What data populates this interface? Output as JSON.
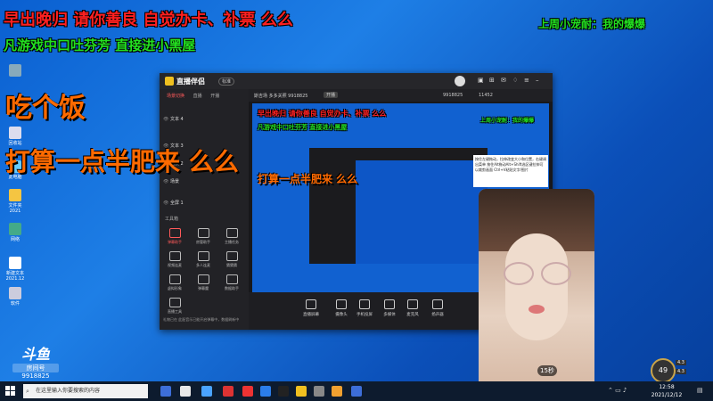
{
  "overlay": {
    "line1": "早出晚归 请你善良  自觉办卡、补票 么么",
    "line2": "凡游戏中口吐芬芳 直接进小黑屋",
    "top_right": "上周小宠耐：我的爆爆",
    "eat": "吃个饭",
    "plan": "打算一点半肥来 么么"
  },
  "desktop_icons": [
    {
      "label": ""
    },
    {
      "label": "回收站"
    },
    {
      "label": "此电脑"
    },
    {
      "label": "文件夹 2021"
    },
    {
      "label": "网络"
    },
    {
      "label": "新建文本 2021.12"
    },
    {
      "label": "软件"
    }
  ],
  "app": {
    "logo": "直播伴侣",
    "logo_tag": "标准",
    "tabs": [
      "场景切换",
      "直播",
      "开播"
    ],
    "scenes": [
      "文本 4",
      "文本 3",
      "场景 2",
      "场景",
      "全屏 1"
    ],
    "tools_title": "工具箱",
    "tools": [
      "弹幕助手",
      "房管助手",
      "主播任务",
      "视频连麦",
      "多人连麦",
      "猜猜猜",
      "虚拟形象",
      "弹幕魔",
      "数据助手",
      "直播工具"
    ],
    "status": "礼物已在   此配音乐已能开启弹幕中，数据刷新中",
    "room": "斯吉场   多多关照 9918825",
    "infobar_tag": "开播",
    "room_id": "9918825",
    "viewers": "11452",
    "buttons": [
      "直播屏幕",
      "摄像头",
      "手机投屏",
      "多媒体",
      "麦克风",
      "扬声器"
    ],
    "tooltip": "按住左键拖动，拉伸改变大小和位置，右键调出菜单 按住Alt拖动Alt+Shift选区键拉伸可以裁剪画面 Ctrl+V粘贴文字/图片"
  },
  "preview": {
    "line1": "早出晚归 请你善良  自觉办卡、补票 么么",
    "line2": "凡游戏中口吐芬芳 直接进小黑屋",
    "top_right": "上周小宠耐：我的爆爆",
    "plan": "打算一点半肥来 么么"
  },
  "camera": {
    "duration": "15秒"
  },
  "watermark": {
    "logo": "斗鱼",
    "room_label": "房间号",
    "room_id": "9918825"
  },
  "badge": {
    "level": "49",
    "small1": "4.3",
    "small2": "4.3"
  },
  "taskbar": {
    "search_placeholder": "在这里输入你要搜索的内容",
    "time": "12:58",
    "date": "2021/12/12",
    "app_colors": [
      "#3d6ed8",
      "#e8e8e8",
      "#4aa3ff",
      "#d33",
      "#e33",
      "#2b7de9",
      "#222",
      "#f0c020",
      "#888",
      "#f0a030"
    ]
  }
}
